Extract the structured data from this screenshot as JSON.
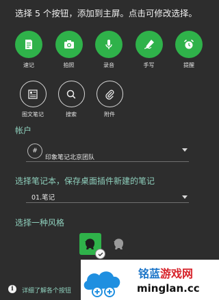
{
  "header": {
    "instruction": "选择 5 个按钮，添加到主屏。点击可修改选择。"
  },
  "buttons_row1": [
    {
      "label": "速记",
      "icon": "note-icon"
    },
    {
      "label": "拍照",
      "icon": "camera-icon"
    },
    {
      "label": "录音",
      "icon": "microphone-icon"
    },
    {
      "label": "手写",
      "icon": "handwriting-icon"
    },
    {
      "label": "提醒",
      "icon": "alarm-clock-icon"
    }
  ],
  "buttons_row2": [
    {
      "label": "图文笔记",
      "icon": "text-image-note-icon"
    },
    {
      "label": "搜索",
      "icon": "search-icon"
    },
    {
      "label": "附件",
      "icon": "paperclip-icon"
    }
  ],
  "account": {
    "section_label": "帐户",
    "icon_text": "#",
    "value": "印象笔记北京团队"
  },
  "notebook": {
    "section_label": "选择笔记本，保存桌面插件新建的笔记",
    "value": "01.笔记"
  },
  "style": {
    "section_label": "选择一种风格"
  },
  "footer": {
    "info_icon_text": "i",
    "link_text": "详细了解各个按钮"
  },
  "watermark": {
    "title_blue": "铭蓝",
    "title_red": "游戏网",
    "site": "minglan.cc"
  },
  "colors": {
    "background": "#2d2d2d",
    "accent_green": "#2fb24a",
    "section_teal": "#8fd0bd"
  }
}
